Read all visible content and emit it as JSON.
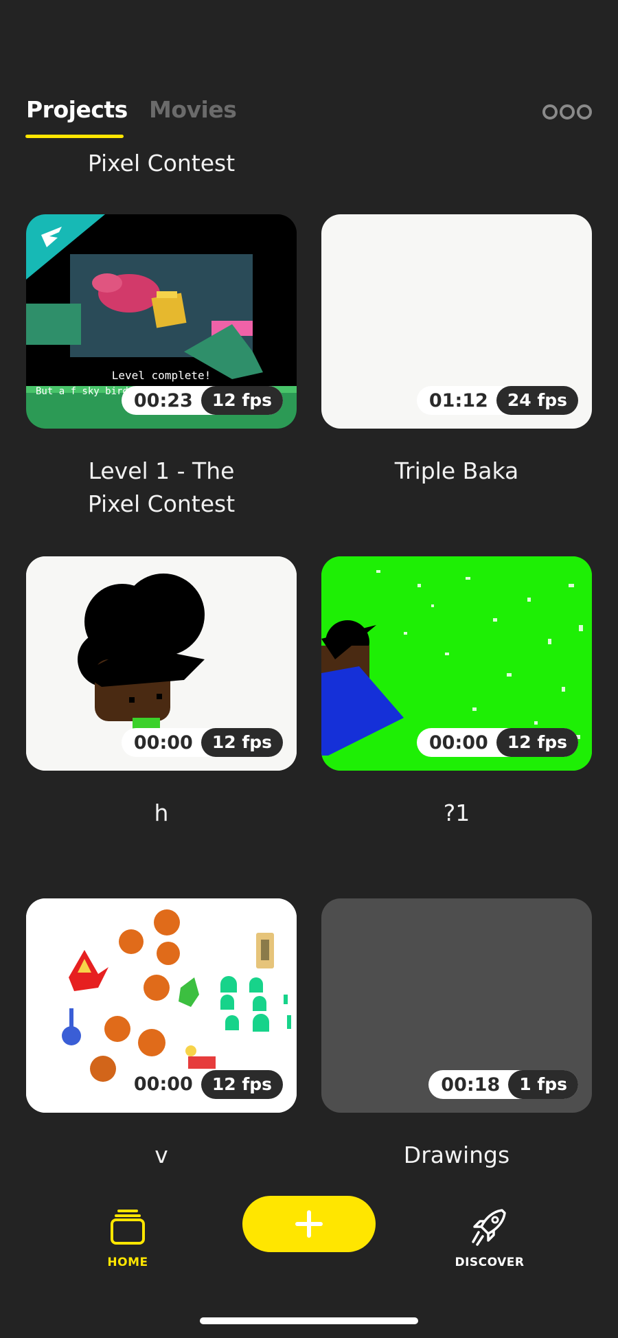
{
  "header": {
    "tabs": [
      {
        "label": "Projects",
        "active": true
      },
      {
        "label": "Movies",
        "active": false
      }
    ],
    "more_icon": "more-dots-icon"
  },
  "partial_title": "Pixel Contest",
  "projects": [
    {
      "title": "Level 1 - The Pixel Contest",
      "duration": "00:23",
      "fps": "12 fps",
      "thumb_text": "Level complete!",
      "thumb_text2": "But a f sky bird"
    },
    {
      "title": "Triple Baka",
      "duration": "01:12",
      "fps": "24 fps"
    },
    {
      "title": "h",
      "duration": "00:00",
      "fps": "12 fps"
    },
    {
      "title": "?1",
      "duration": "00:00",
      "fps": "12 fps"
    },
    {
      "title": "v",
      "duration": "00:00",
      "fps": "12 fps"
    },
    {
      "title": "Drawings",
      "duration": "00:18",
      "fps": "1 fps"
    }
  ],
  "bottom_nav": {
    "home_label": "HOME",
    "discover_label": "DISCOVER",
    "add_icon": "plus-icon"
  },
  "colors": {
    "accent": "#ffe600",
    "background": "#232323",
    "pill_dark": "#2b2b2b"
  }
}
